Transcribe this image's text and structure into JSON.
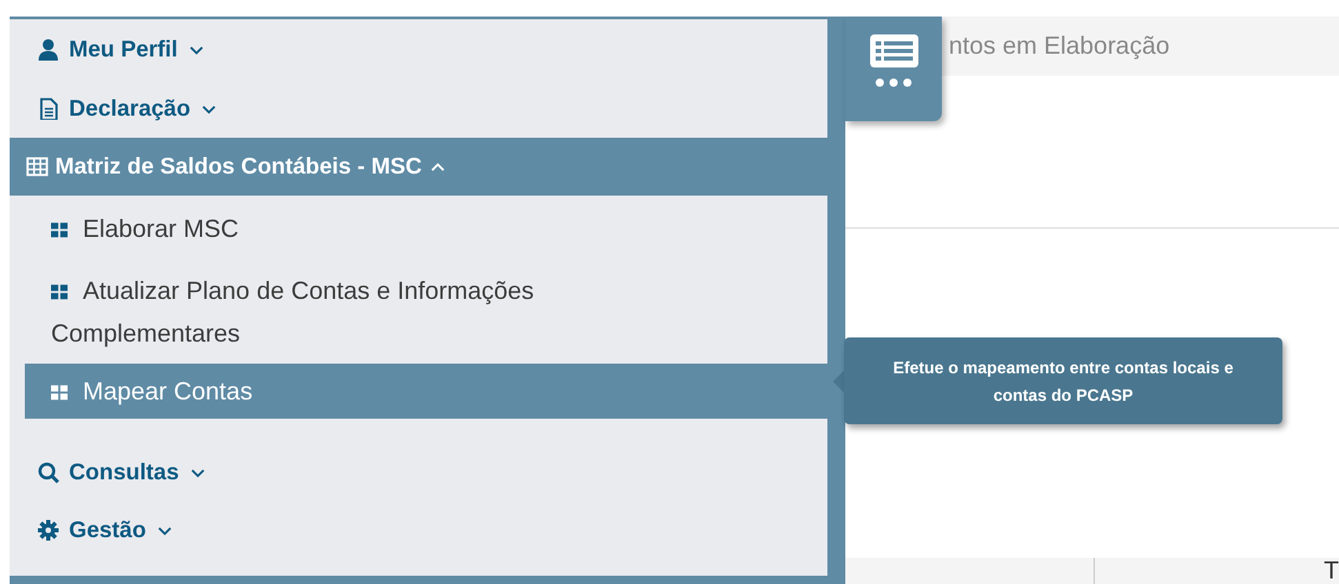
{
  "menu": {
    "items": [
      {
        "kind": "section",
        "label": "Meu Perfil",
        "expanded": false,
        "selected": false
      },
      {
        "kind": "section",
        "label": "Declaração",
        "expanded": false,
        "selected": false
      },
      {
        "kind": "section",
        "label": "Matriz de Saldos Contábeis - MSC",
        "expanded": true,
        "selected": true,
        "children": [
          {
            "label": "Elaborar MSC",
            "selected": false
          },
          {
            "label": "Atualizar Plano de Contas e Informações Complementares",
            "selected": false
          },
          {
            "label": "Mapear Contas",
            "selected": true
          }
        ]
      },
      {
        "kind": "section",
        "label": "Consultas",
        "expanded": false,
        "selected": false
      },
      {
        "kind": "section",
        "label": "Gestão",
        "expanded": false,
        "selected": false
      }
    ]
  },
  "page": {
    "tab_label": "ntos em Elaboração",
    "table": {
      "columns": [
        "T"
      ]
    }
  },
  "tooltip": {
    "text": "Efetue o mapeamento entre contas locais e contas do PCASP"
  }
}
